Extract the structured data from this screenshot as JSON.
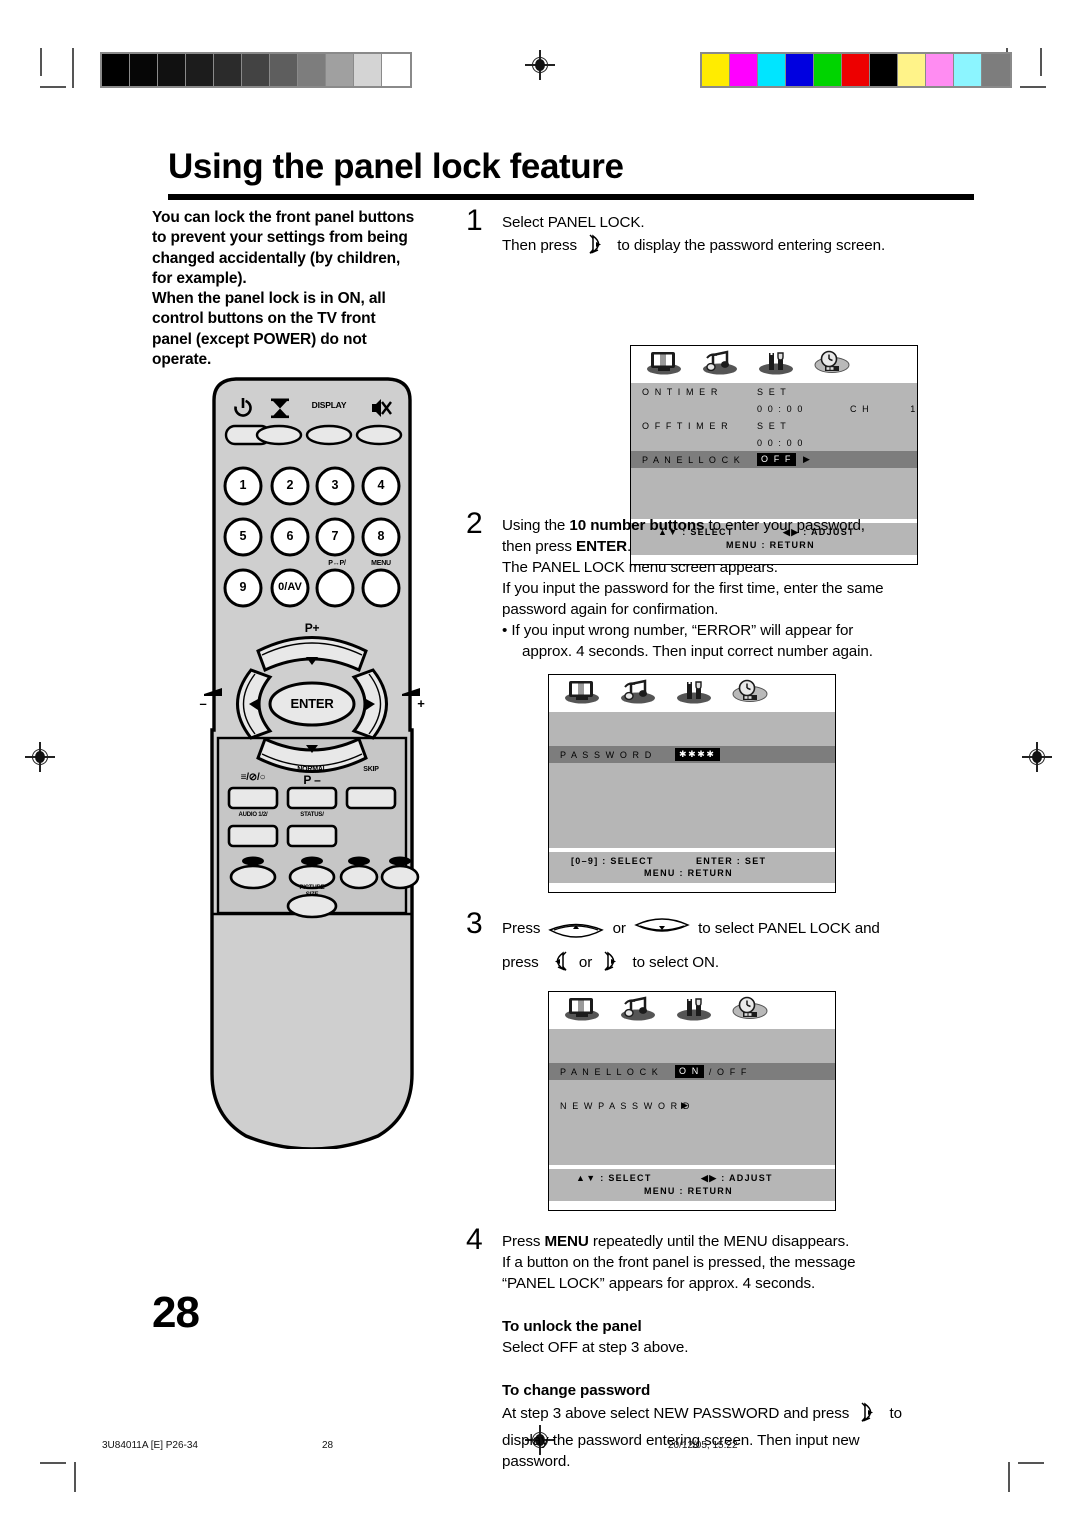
{
  "document": {
    "title": "Using the panel lock feature",
    "page_number": "28"
  },
  "intro": {
    "lines": [
      "You can lock the front panel buttons",
      "to prevent your settings from being",
      "changed accidentally (by children,",
      "for example).",
      "When the panel lock is in ON, all",
      "control buttons on the TV front",
      "panel (except POWER) do not",
      "operate."
    ]
  },
  "remote": {
    "top_row": [
      "power-icon",
      "timer-icon",
      "DISPLAY",
      "mute-icon"
    ],
    "numbers": [
      "1",
      "2",
      "3",
      "4",
      "5",
      "6",
      "7",
      "8",
      "9",
      "0/AV"
    ],
    "swap_label": "P↔P/",
    "menu_label": "MENU",
    "nav": {
      "up": "P+",
      "down": "P –",
      "left": "–",
      "right": "+",
      "center": "ENTER"
    },
    "bottom": {
      "teletext": "≡/⊘/○",
      "normal": "NORMAL",
      "skip": "SKIP",
      "audio": "AUDIO 1/2/",
      "status": "STATUS/",
      "picture_size_l1": "PICTURE",
      "picture_size_l2": "SIZE"
    }
  },
  "steps": [
    {
      "num": "1",
      "lines": [
        "Select PANEL LOCK.",
        "Then press [right-key] to display the password entering screen."
      ]
    },
    {
      "num": "2",
      "lines": [
        "Using the 10 number buttons to enter your password,",
        "then press ENTER.",
        "The PANEL LOCK menu screen appears.",
        "If you input the password for the first time, enter the same",
        "password again for confirmation.",
        "• If you input wrong number, “ERROR” will appear for",
        "approx. 4 seconds. Then input correct number again."
      ],
      "bold_fragments": [
        "10 number buttons",
        "ENTER"
      ]
    },
    {
      "num": "3",
      "lines": [
        "Press [up-key] or [down-key] to select PANEL LOCK and",
        "press [left-key] or [right-key] to select ON."
      ]
    },
    {
      "num": "4",
      "lines": [
        "Press MENU repeatedly until the MENU disappears.",
        "If a button on the front panel is pressed, the message",
        "“PANEL LOCK” appears for approx. 4 seconds."
      ],
      "bold_fragments": [
        "MENU"
      ]
    }
  ],
  "step2_text": {
    "p1_a": "Using the ",
    "p1_b": "10 number buttons",
    "p1_c": " to enter your password,",
    "p2_a": "then press ",
    "p2_b": "ENTER",
    "p2_c": ".",
    "p3": "The PANEL LOCK menu screen appears.",
    "p4": "If you input the password for the first time, enter the same",
    "p5": "password again for confirmation.",
    "p6": "• If you input wrong number, “ERROR” will appear for",
    "p7": "approx. 4 seconds. Then input correct number again."
  },
  "step1_text": {
    "p1": "Select PANEL LOCK.",
    "p2_a": "Then press",
    "p2_b": "to display the password entering screen."
  },
  "step3_text": {
    "p1_a": "Press",
    "p1_b": "or",
    "p1_c": "to select PANEL LOCK and",
    "p2_a": "press",
    "p2_b": "or",
    "p2_c": "to select ON."
  },
  "step4_text": {
    "p1_a": "Press ",
    "p1_b": "MENU",
    "p1_c": " repeatedly until the MENU disappears.",
    "p2": "If a button on the front panel is pressed, the message",
    "p3": "“PANEL LOCK” appears for approx. 4 seconds."
  },
  "notes": {
    "unlock_head": "To unlock the panel",
    "unlock_body": "Select OFF at step 3 above.",
    "change_head": "To change password",
    "change_l1_a": "At step 3 above select NEW PASSWORD and press",
    "change_l1_b": "to",
    "change_l2": "display the password entering screen. Then input new",
    "change_l3": "password."
  },
  "osd": {
    "icons": [
      "picture-icon",
      "sound-icon",
      "function-icon",
      "timer-icon"
    ],
    "screen1": {
      "rows": [
        {
          "label": "O N  T I M E R",
          "value": "S E T",
          "value2": "",
          "value3": ""
        },
        {
          "label": "",
          "value": "0 0 : 0 0",
          "value2": "C H",
          "value3": "1"
        },
        {
          "label": "O F F  T I M E R",
          "value": "S E T",
          "value2": "",
          "value3": ""
        },
        {
          "label": "",
          "value": "0 0 : 0 0",
          "value2": "",
          "value3": ""
        }
      ],
      "highlight": {
        "label": "P A N E L  L O C K",
        "chip": "O F F",
        "arrow": "▶"
      },
      "footer": {
        "left": "▲▼ : SELECT",
        "right": "◀▶ : ADJUST",
        "bottom": "MENU : RETURN"
      }
    },
    "screen2": {
      "highlight": {
        "label": "P A S S W O R D",
        "chip": "✱✱✱✱"
      },
      "footer": {
        "left": "[0–9] : SELECT",
        "right": "ENTER : SET",
        "bottom": "MENU : RETURN"
      }
    },
    "screen3": {
      "highlight": {
        "label": "P A N E L  L O C K",
        "chip": "O N",
        "suffix": "/ O F F"
      },
      "row": {
        "label": "N E W  P A S S W O R D",
        "arrow": "▶"
      },
      "footer": {
        "left": "▲▼ : SELECT",
        "right": "◀▶ : ADJUST",
        "bottom": "MENU : RETURN"
      }
    }
  },
  "calibration": {
    "grayscale": [
      "#000000",
      "#060606",
      "#111111",
      "#1c1c1c",
      "#2b2b2b",
      "#434343",
      "#5e5e5e",
      "#7d7d7d",
      "#a0a0a0",
      "#d4d4d4",
      "#ffffff"
    ],
    "colors": [
      "#ffec00",
      "#ff00ff",
      "#00e5ff",
      "#0000e0",
      "#00d400",
      "#ed0000",
      "#000000",
      "#fff389",
      "#ff8cf2",
      "#8cf5ff",
      "#7d7d7d"
    ]
  },
  "footer": {
    "left": "3U84011A [E] P26-34",
    "center": "28",
    "right": "20/12/05, 15:22"
  }
}
